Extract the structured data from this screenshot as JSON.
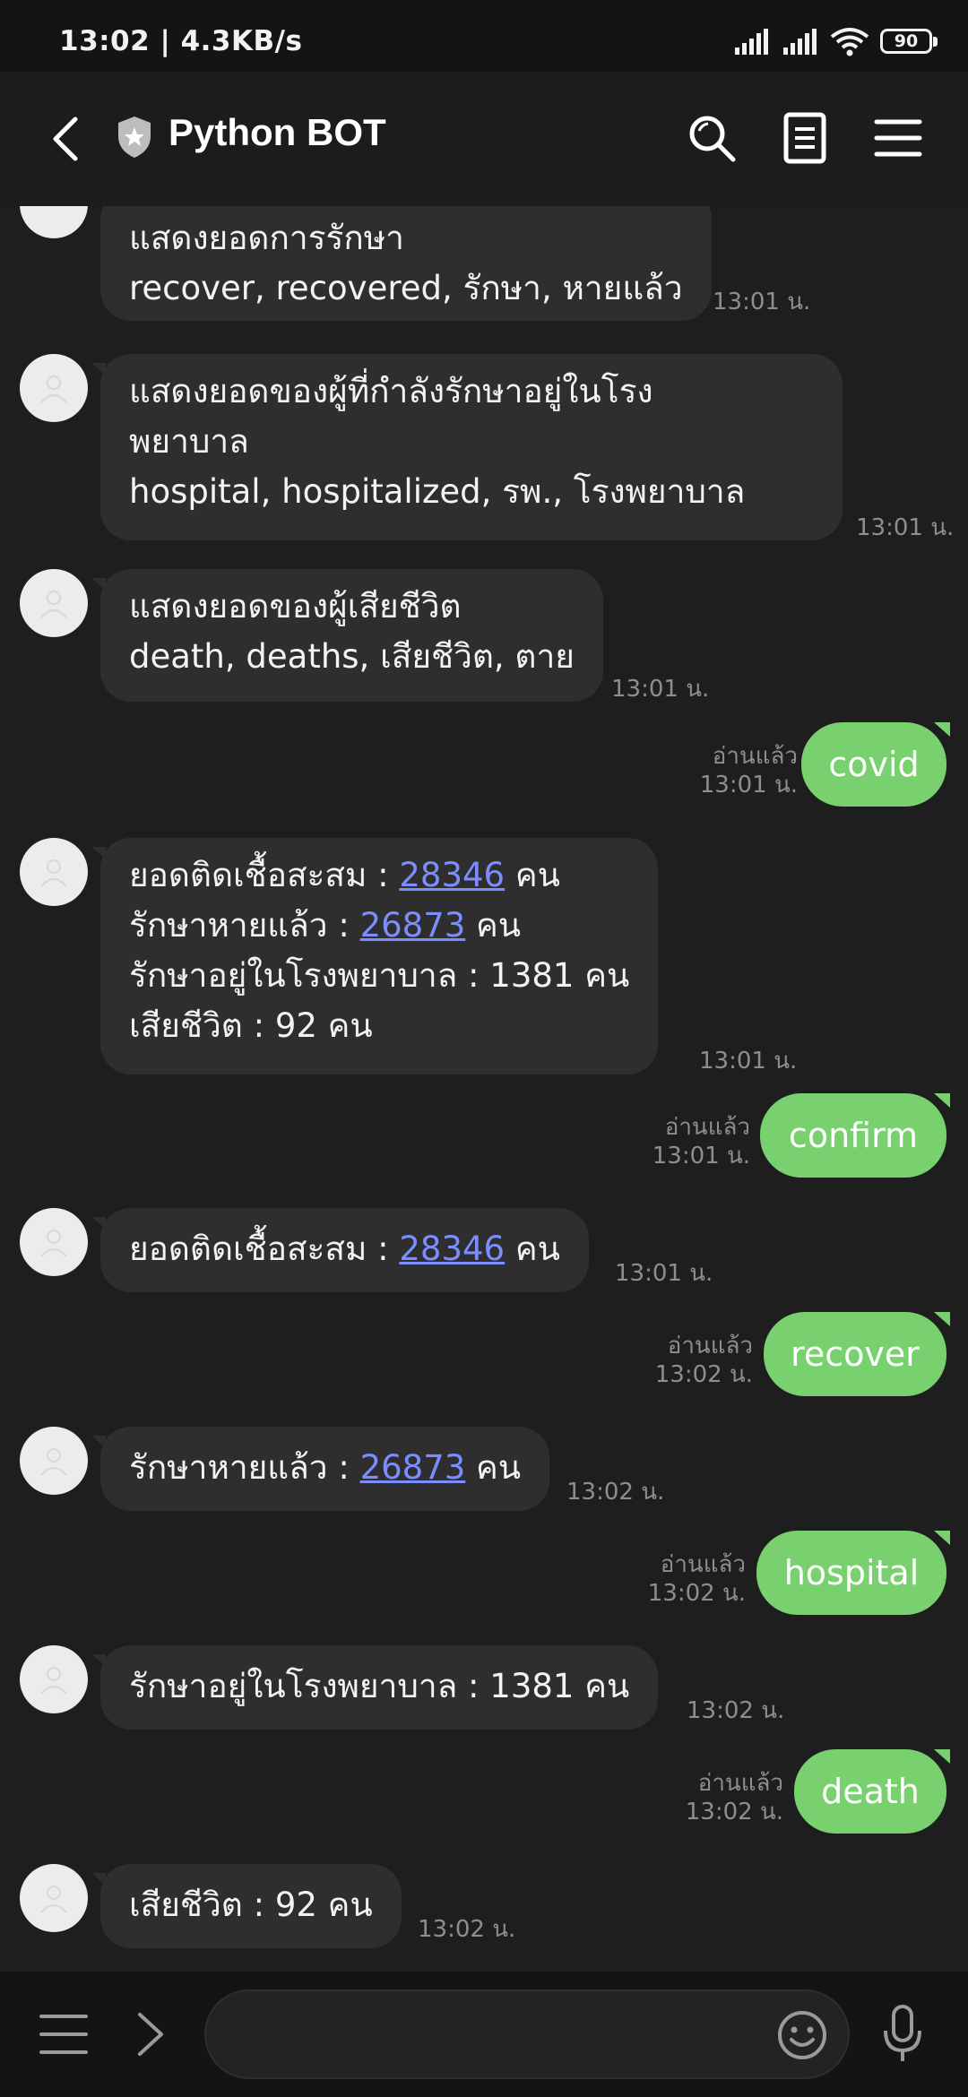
{
  "status": {
    "time": "13:02 | 4.3KB/s",
    "battery": "90"
  },
  "header": {
    "title": "Python BOT"
  },
  "messages": [
    {
      "line1": "แสดงยอดการรักษา",
      "line2": "recover, recovered, รักษา, หายแล้ว",
      "time": "13:01 น."
    },
    {
      "line1": "แสดงยอดของผู้ที่กำลังรักษาอยู่ในโรง",
      "line2": "พยาบาล",
      "line3": "hospital, hospitalized, รพ., โรงพยาบาล",
      "time": "13:01 น."
    },
    {
      "line1": "แสดงยอดของผู้เสียชีวิต",
      "line2": "death, deaths, เสียชีวิต, ตาย",
      "time": "13:01 น."
    },
    {
      "text": "covid",
      "read": "อ่านแล้ว",
      "time": "13:01 น."
    },
    {
      "l1_prefix": "ยอดติดเชื้อสะสม : ",
      "l1_num": "28346",
      "l1_suffix": " คน",
      "l2_prefix": "รักษาหายแล้ว : ",
      "l2_num": "26873",
      "l2_suffix": " คน",
      "line3": "รักษาอยู่ในโรงพยาบาล : 1381 คน",
      "line4": "เสียชีวิต : 92 คน",
      "time": "13:01 น."
    },
    {
      "text": "confirm",
      "read": "อ่านแล้ว",
      "time": "13:01 น."
    },
    {
      "prefix": "ยอดติดเชื้อสะสม : ",
      "num": "28346",
      "suffix": " คน",
      "time": "13:01 น."
    },
    {
      "text": "recover",
      "read": "อ่านแล้ว",
      "time": "13:02 น."
    },
    {
      "prefix": "รักษาหายแล้ว : ",
      "num": "26873",
      "suffix": " คน",
      "time": "13:02 น."
    },
    {
      "text": "hospital",
      "read": "อ่านแล้ว",
      "time": "13:02 น."
    },
    {
      "text": "รักษาอยู่ในโรงพยาบาล : 1381 คน",
      "time": "13:02 น."
    },
    {
      "text": "death",
      "read": "อ่านแล้ว",
      "time": "13:02 น."
    },
    {
      "text": "เสียชีวิต : 92 คน",
      "time": "13:02 น."
    }
  ],
  "composer": {
    "placeholder": ""
  },
  "colors": {
    "outgoing_bubble": "#78d16e",
    "incoming_bubble": "#2e2e2e",
    "link": "#7b8dff",
    "background": "#1e1e1e"
  },
  "icons": [
    "back-arrow-icon",
    "shield-star-icon",
    "search-icon",
    "notes-icon",
    "menu-icon",
    "hamburger-icon",
    "chevron-right-icon",
    "emoji-icon",
    "microphone-icon",
    "default-avatar-icon"
  ]
}
